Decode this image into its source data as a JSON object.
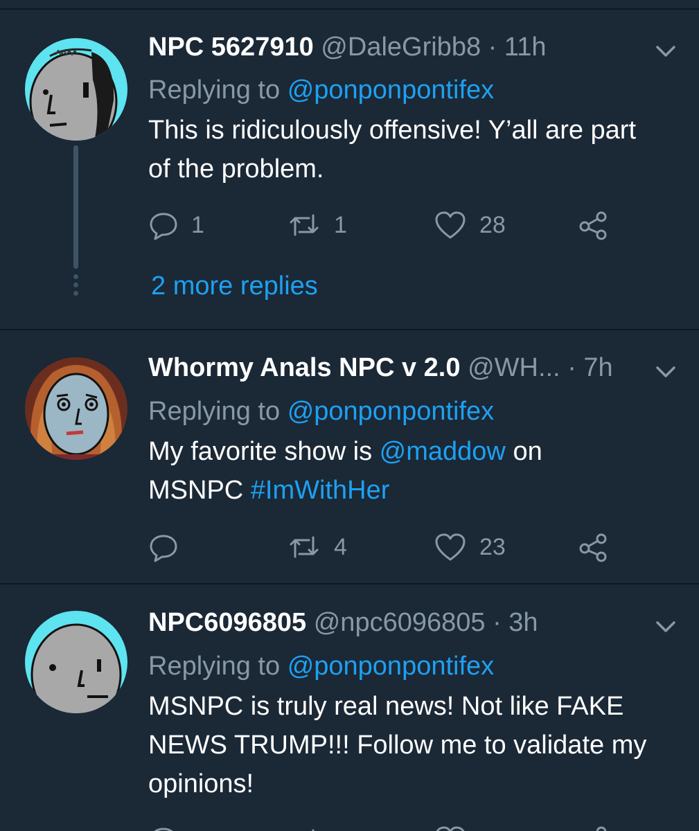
{
  "tweets": [
    {
      "display_name": "NPC 5627910",
      "handle": "@DaleGribb8",
      "time": "11h",
      "replying_prefix": "Replying to",
      "replying_to": "@ponponpontifex",
      "body": "This is ridiculously offensive! Y’all are part of the problem.",
      "reply_count": "1",
      "retweet_count": "1",
      "like_count": "28",
      "more_replies": "2 more replies"
    },
    {
      "display_name": "Whormy Anals NPC v 2.0",
      "handle": "@WH...",
      "time": "7h",
      "replying_prefix": "Replying to",
      "replying_to": "@ponponpontifex",
      "body_part1": "My favorite show is",
      "body_mention": "@maddow",
      "body_part2": "on",
      "body_part3": "MSNPC",
      "body_hashtag": "#ImWithHer",
      "reply_count": "",
      "retweet_count": "4",
      "like_count": "23"
    },
    {
      "display_name": "NPC6096805",
      "handle": "@npc6096805",
      "time": "3h",
      "replying_prefix": "Replying to",
      "replying_to": "@ponponpontifex",
      "body": "MSNPC is truly real news! Not like FAKE NEWS TRUMP!!! Follow me to validate my opinions!"
    }
  ],
  "dot": "·",
  "colors": {
    "background": "#1b2836",
    "text": "#ffffff",
    "muted": "#8899a6",
    "link": "#1da1f2",
    "divider": "#0f1822"
  },
  "icons": [
    "chevron-down-icon",
    "reply-icon",
    "retweet-icon",
    "heart-icon",
    "share-icon"
  ]
}
